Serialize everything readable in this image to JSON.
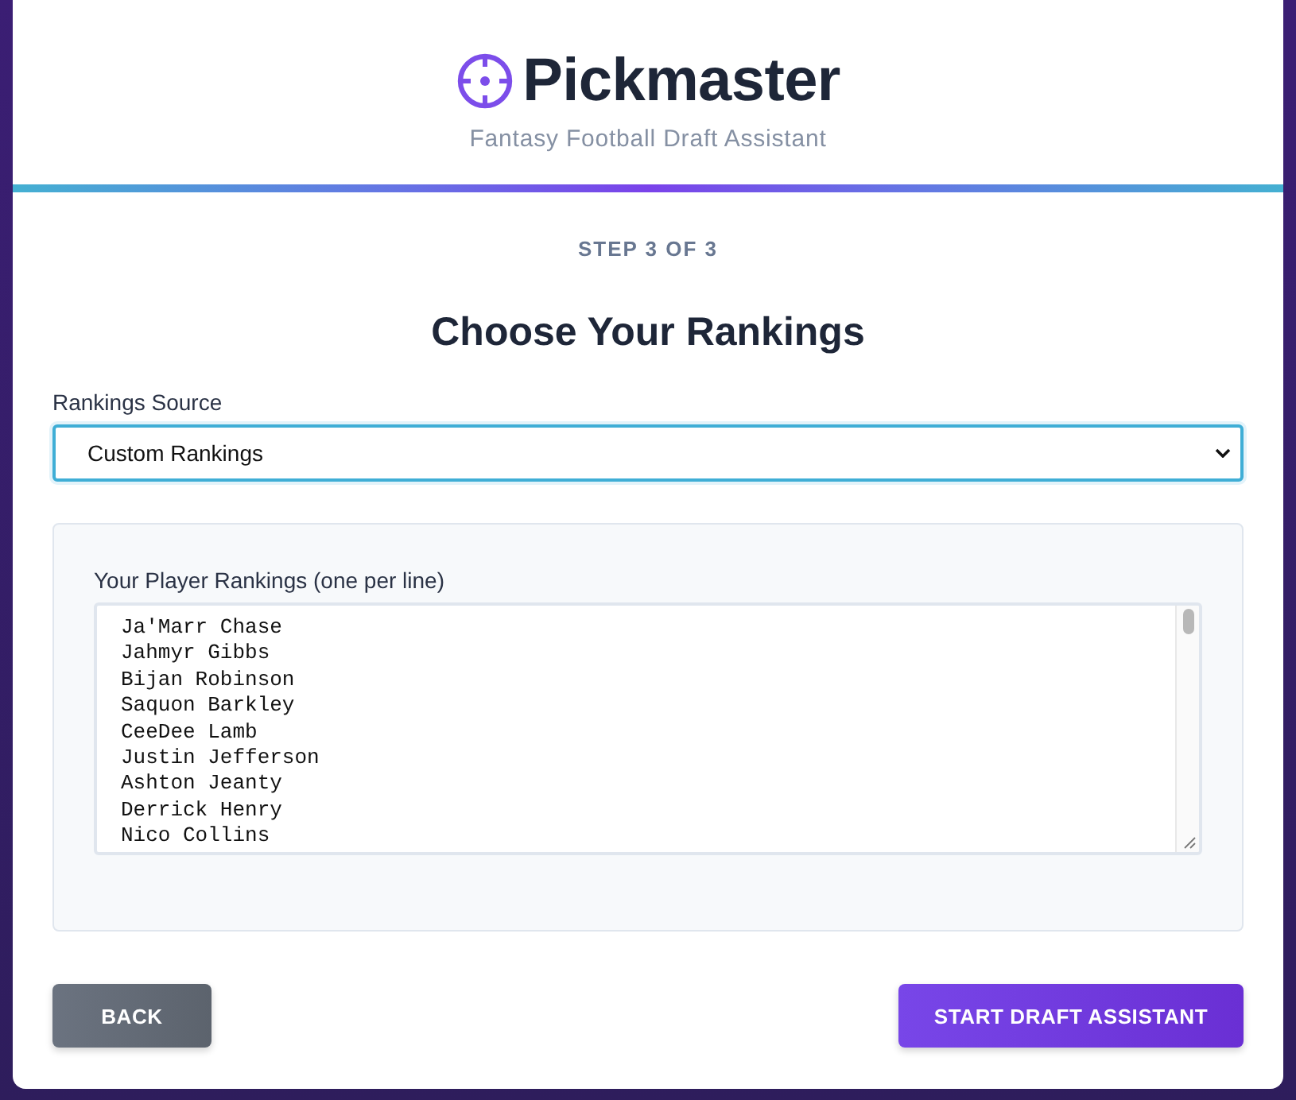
{
  "header": {
    "title": "Pickmaster",
    "subtitle": "Fantasy Football Draft Assistant"
  },
  "step": "STEP 3 OF 3",
  "heading": "Choose Your Rankings",
  "source": {
    "label": "Rankings Source",
    "value": "Custom Rankings",
    "focused": true
  },
  "rankings": {
    "label": "Your Player Rankings (one per line)",
    "lines": [
      "Ja'Marr Chase",
      "Jahmyr Gibbs",
      "Bijan Robinson",
      "Saquon Barkley",
      "CeeDee Lamb",
      "Justin Jefferson",
      "Ashton Jeanty",
      "Derrick Henry",
      "Nico Collins"
    ]
  },
  "buttons": [
    {
      "label": "BACK",
      "kind": "secondary"
    },
    {
      "label": "START DRAFT ASSISTANT",
      "kind": "primary"
    }
  ]
}
